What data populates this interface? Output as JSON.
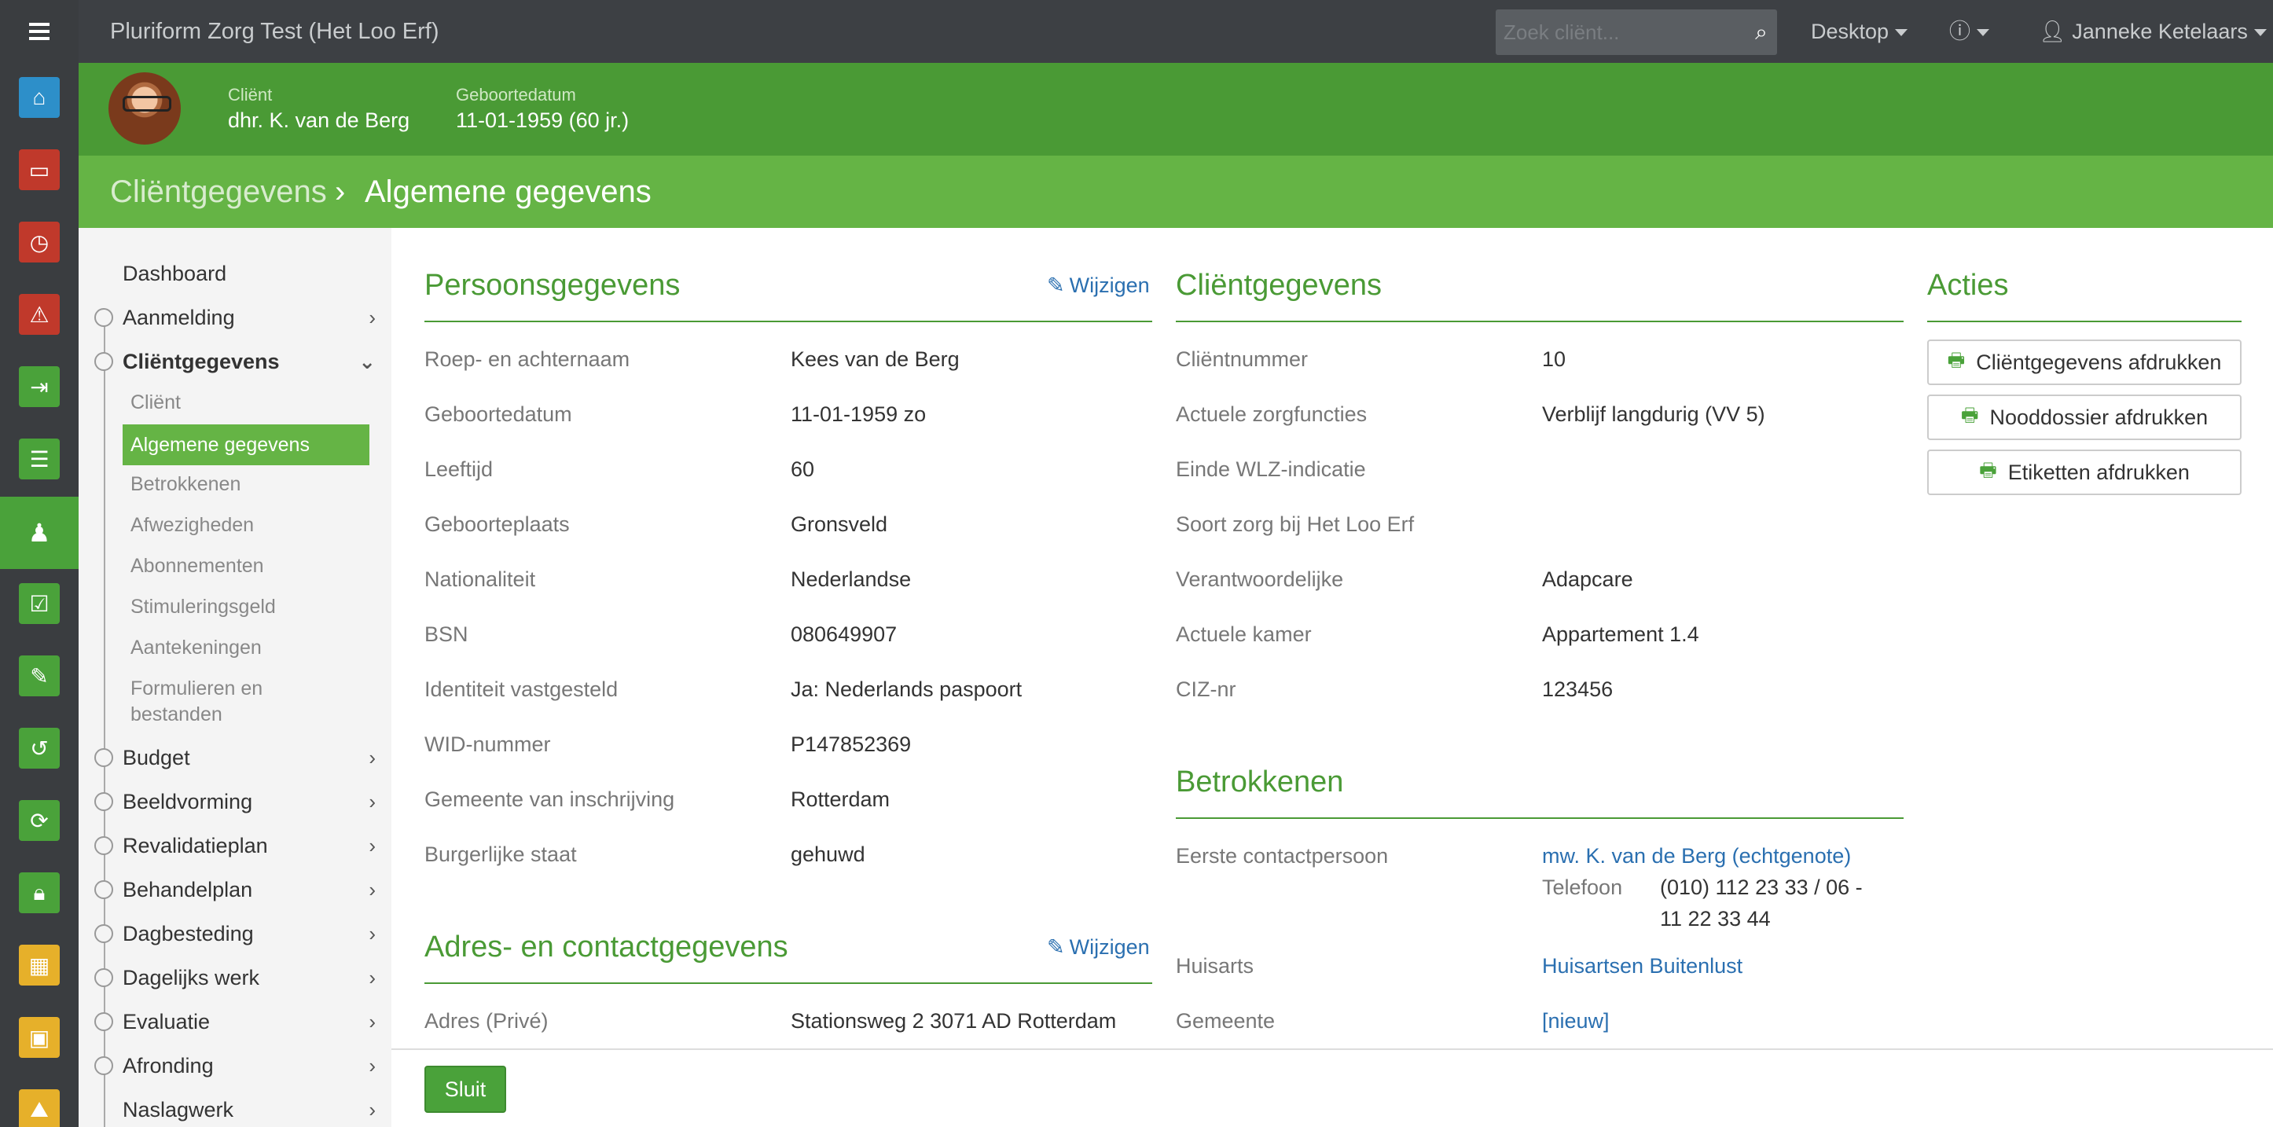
{
  "rail": {
    "items": [
      {
        "icon": "home-icon",
        "color": "#2d8fc9"
      },
      {
        "icon": "inbox-icon",
        "color": "#c0392b"
      },
      {
        "icon": "clock-icon",
        "color": "#c0392b"
      },
      {
        "icon": "warning-icon",
        "color": "#c0392b"
      },
      {
        "icon": "sign-in-icon",
        "color": "#4aa23a"
      },
      {
        "icon": "list-icon",
        "color": "#4aa23a"
      },
      {
        "icon": "person-icon",
        "color": "#4aa23a"
      },
      {
        "icon": "calendar-check-icon",
        "color": "#4aa23a"
      },
      {
        "icon": "pencil-icon",
        "color": "#4aa23a"
      },
      {
        "icon": "undo-icon",
        "color": "#4aa23a"
      },
      {
        "icon": "refresh-icon",
        "color": "#4aa23a"
      },
      {
        "icon": "lock-icon",
        "color": "#4aa23a"
      },
      {
        "icon": "calendar-icon",
        "color": "#e6b02a"
      },
      {
        "icon": "briefcase-icon",
        "color": "#e6b02a"
      },
      {
        "icon": "road-icon",
        "color": "#e6b02a"
      }
    ]
  },
  "topbar": {
    "app_title": "Pluriform Zorg Test  (Het Loo Erf)",
    "search_placeholder": "Zoek cliënt...",
    "desktop": "Desktop",
    "user": "Janneke Ketelaars"
  },
  "client": {
    "client_label": "Cliënt",
    "client_name": "dhr. K. van de Berg",
    "dob_label": "Geboortedatum",
    "dob_value": "11-01-1959 (60 jr.)"
  },
  "breadcrumb": {
    "parent": "Cliëntgegevens",
    "separator": "›",
    "current": "Algemene gegevens"
  },
  "nav": {
    "dashboard": "Dashboard",
    "aanmelding": "Aanmelding",
    "clientgegevens": "Cliëntgegevens",
    "sub": {
      "client": "Cliënt",
      "algemene": "Algemene gegevens",
      "betrokkenen": "Betrokkenen",
      "afwezigheden": "Afwezigheden",
      "abonnementen": "Abonnementen",
      "stimuleringsgeld": "Stimuleringsgeld",
      "aantekeningen": "Aantekeningen",
      "formulieren_1": "Formulieren en",
      "formulieren_2": "bestanden"
    },
    "budget": "Budget",
    "beeldvorming": "Beeldvorming",
    "revalidatieplan": "Revalidatieplan",
    "behandelplan": "Behandelplan",
    "dagbesteding": "Dagbesteding",
    "dagelijks_werk": "Dagelijks werk",
    "evaluatie": "Evaluatie",
    "afronding": "Afronding",
    "naslagwerk": "Naslagwerk"
  },
  "persoonsgegevens": {
    "title": "Persoonsgegevens",
    "edit": "Wijzigen",
    "rows": [
      {
        "label": "Roep- en achternaam",
        "value": "Kees van de Berg"
      },
      {
        "label": "Geboortedatum",
        "value": "11-01-1959 zo"
      },
      {
        "label": "Leeftijd",
        "value": "60"
      },
      {
        "label": "Geboorteplaats",
        "value": "Gronsveld"
      },
      {
        "label": "Nationaliteit",
        "value": "Nederlandse"
      },
      {
        "label": "BSN",
        "value": "080649907"
      },
      {
        "label": "Identiteit vastgesteld",
        "value": "Ja: Nederlands paspoort"
      },
      {
        "label": "WID-nummer",
        "value": "P147852369"
      },
      {
        "label": "Gemeente van inschrijving",
        "value": "Rotterdam"
      },
      {
        "label": "Burgerlijke staat",
        "value": "gehuwd"
      }
    ]
  },
  "adres": {
    "title": "Adres- en contactgegevens",
    "edit": "Wijzigen",
    "label": "Adres (Privé)",
    "value": "Stationsweg 2 3071 AD Rotterdam"
  },
  "clientgegevens": {
    "title": "Cliëntgegevens",
    "rows": [
      {
        "label": "Cliëntnummer",
        "value": "10"
      },
      {
        "label": "Actuele zorgfuncties",
        "value": "Verblijf langdurig (VV 5)"
      },
      {
        "label": "Einde WLZ-indicatie",
        "value": ""
      },
      {
        "label": "Soort zorg bij Het Loo Erf",
        "value": ""
      },
      {
        "label": "Verantwoordelijke",
        "value": "Adapcare"
      },
      {
        "label": "Actuele kamer",
        "value": "Appartement 1.4"
      },
      {
        "label": "CIZ-nr",
        "value": "123456"
      }
    ]
  },
  "betrokkenen": {
    "title": "Betrokkenen",
    "contact_label": "Eerste contactpersoon",
    "contact_link": "mw. K. van de Berg (echtgenote)",
    "phone_label": "Telefoon",
    "phone_1": "(010) 112 23 33 / 06 -",
    "phone_2": "11 22 33 44",
    "huisarts_label": "Huisarts",
    "huisarts_link": "Huisartsen Buitenlust",
    "gemeente_label": "Gemeente",
    "gemeente_link": "[nieuw]"
  },
  "acties": {
    "title": "Acties",
    "buttons": [
      "Cliëntgegevens afdrukken",
      "Nooddossier afdrukken",
      "Etiketten afdrukken"
    ]
  },
  "footer": {
    "close": "Sluit"
  }
}
